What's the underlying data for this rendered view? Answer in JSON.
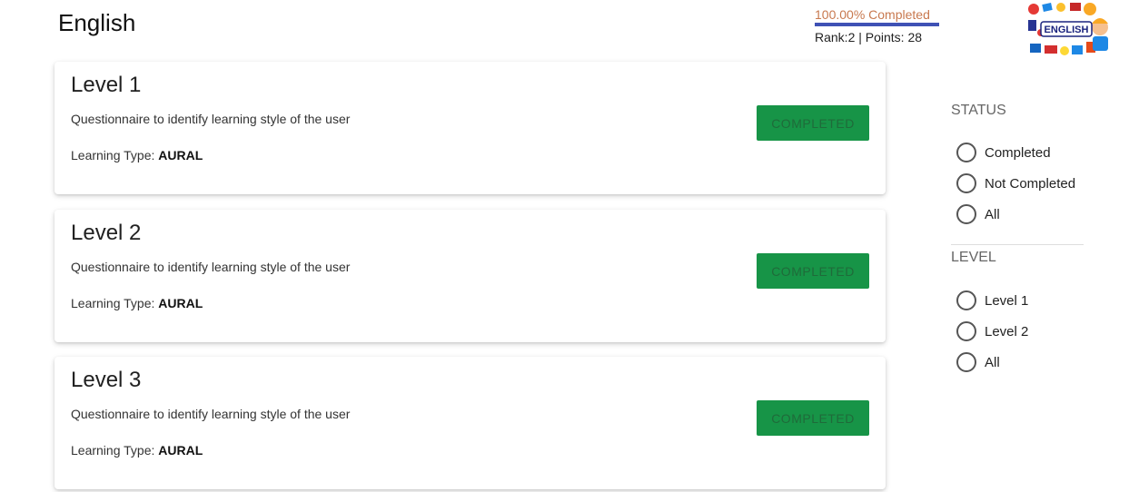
{
  "header": {
    "course_title": "English",
    "progress_text": "100.00% Completed",
    "progress_fraction": 1.0,
    "rank_text": "Rank:2 | Points: 28",
    "logo_label": "ENGLISH",
    "accent_color": "#3f51b5",
    "progress_text_color": "#c8794f"
  },
  "levels": [
    {
      "title": "Level 1",
      "description": "Questionnaire to identify learning style of the user",
      "type_label": "Learning Type: ",
      "type_value": "AURAL",
      "status_button": "COMPLETED"
    },
    {
      "title": "Level 2",
      "description": "Questionnaire to identify learning style of the user",
      "type_label": "Learning Type: ",
      "type_value": "AURAL",
      "status_button": "COMPLETED"
    },
    {
      "title": "Level 3",
      "description": "Questionnaire to identify learning style of the user",
      "type_label": "Learning Type: ",
      "type_value": "AURAL",
      "status_button": "COMPLETED"
    }
  ],
  "filters": {
    "status": {
      "heading": "STATUS",
      "options": [
        "Completed",
        "Not Completed",
        "All"
      ]
    },
    "level": {
      "heading": "LEVEL",
      "options": [
        "Level 1",
        "Level 2",
        "All"
      ]
    }
  },
  "colors": {
    "completed_button": "#179447"
  }
}
